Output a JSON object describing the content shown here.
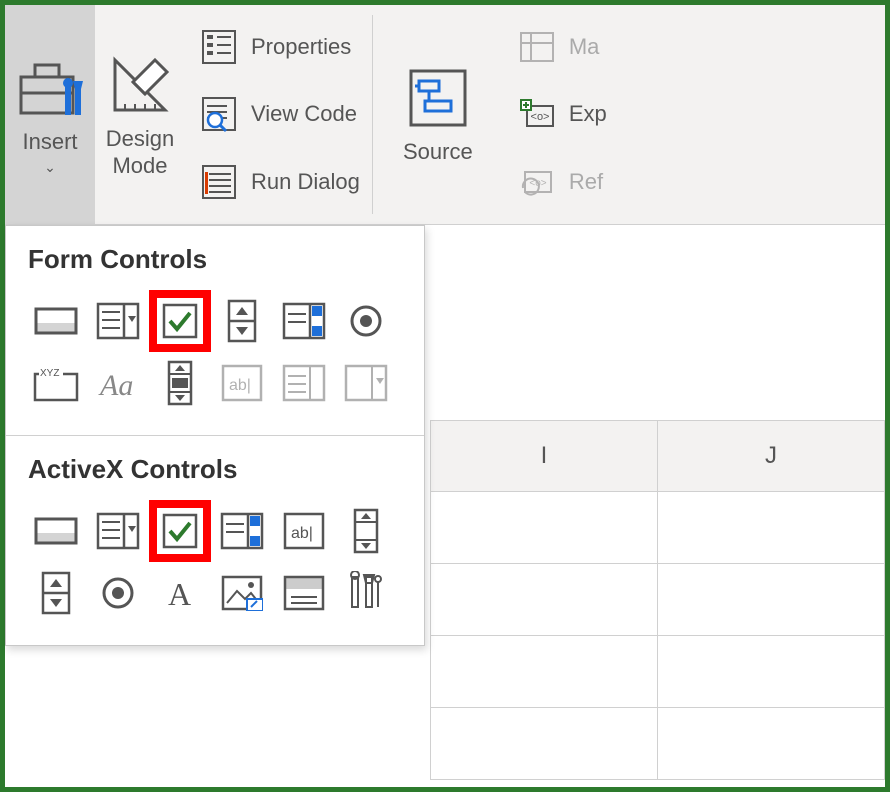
{
  "ribbon": {
    "insert": {
      "label": "Insert"
    },
    "design_mode": {
      "label": "Design\nMode"
    },
    "properties": {
      "label": "Properties"
    },
    "view_code": {
      "label": "View Code"
    },
    "run_dialog": {
      "label": "Run Dialog"
    },
    "source": {
      "label": "Source"
    },
    "map": {
      "label": "Ma"
    },
    "expansion": {
      "label": "Exp"
    },
    "refresh": {
      "label": "Ref"
    }
  },
  "dropdown": {
    "form_controls": {
      "title": "Form Controls"
    },
    "activex_controls": {
      "title": "ActiveX Controls"
    }
  },
  "sheet": {
    "columns": [
      "I",
      "J"
    ]
  }
}
